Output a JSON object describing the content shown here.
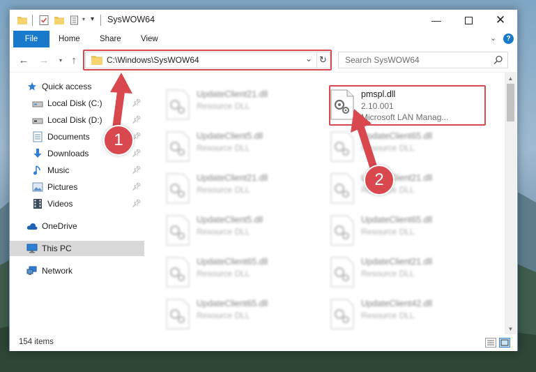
{
  "window": {
    "title": "SysWOW64"
  },
  "ribbon": {
    "tabs": [
      "File",
      "Home",
      "Share",
      "View"
    ]
  },
  "address": {
    "path": "C:\\Windows\\SysWOW64"
  },
  "search": {
    "placeholder": "Search SysWOW64"
  },
  "nav_pane": {
    "items": [
      {
        "label": "Quick access",
        "icon": "star-icon"
      },
      {
        "label": "Local Disk (C:)",
        "icon": "drive-icon",
        "pinned": true
      },
      {
        "label": "Local Disk (D:)",
        "icon": "drive-icon",
        "pinned": true
      },
      {
        "label": "Documents",
        "icon": "documents-icon",
        "pinned": true
      },
      {
        "label": "Downloads",
        "icon": "download-icon",
        "pinned": true
      },
      {
        "label": "Music",
        "icon": "music-icon",
        "pinned": true
      },
      {
        "label": "Pictures",
        "icon": "pictures-icon",
        "pinned": true
      },
      {
        "label": "Videos",
        "icon": "videos-icon",
        "pinned": true
      },
      {
        "label": "OneDrive",
        "icon": "cloud-icon"
      },
      {
        "label": "This PC",
        "icon": "computer-icon",
        "selected": true
      },
      {
        "label": "Network",
        "icon": "network-icon"
      }
    ]
  },
  "files": [
    {
      "name": "UpdateClient21.dll",
      "type": "Resource DLL"
    },
    {
      "name": "pmspl.dll",
      "version": "2.10.001",
      "description": "Microsoft LAN Manag...",
      "highlighted": true
    },
    {
      "name": "UpdateClient5.dll",
      "type": "Resource DLL"
    },
    {
      "name": "UpdateClient65.dll",
      "type": "Resource DLL"
    },
    {
      "name": "UpdateClient21.dll",
      "type": "Resource DLL"
    },
    {
      "name": "UpdateClient21.dll",
      "type": "Resource DLL"
    },
    {
      "name": "UpdateClient5.dll",
      "type": "Resource DLL"
    },
    {
      "name": "UpdateClient65.dll",
      "type": "Resource DLL"
    },
    {
      "name": "UpdateClient65.dll",
      "type": "Resource DLL"
    },
    {
      "name": "UpdateClient21.dll",
      "type": "Resource DLL"
    },
    {
      "name": "UpdateClient65.dll",
      "type": "Resource DLL"
    },
    {
      "name": "UpdateClient42.dll",
      "type": "Resource DLL"
    }
  ],
  "status_bar": {
    "item_count": "154 items"
  },
  "callouts": {
    "one": "1",
    "two": "2"
  },
  "colors": {
    "accent": "#1979ca",
    "highlight": "#d9484f"
  }
}
